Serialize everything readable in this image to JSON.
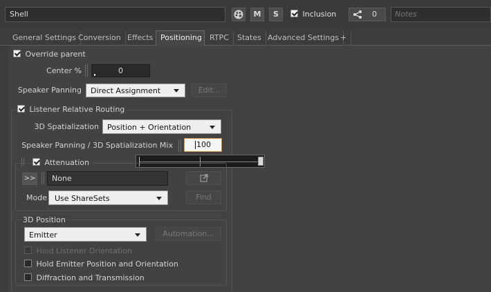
{
  "header": {
    "name_value": "Shell",
    "color_icon": "palette-icon",
    "mute_label": "M",
    "solo_label": "S",
    "inclusion_label": "Inclusion",
    "references_count": "0",
    "notes_placeholder": "Notes"
  },
  "tabs": [
    {
      "label": "General Settings"
    },
    {
      "label": "Conversion"
    },
    {
      "label": "Effects"
    },
    {
      "label": "Positioning",
      "active": true
    },
    {
      "label": "RTPC"
    },
    {
      "label": "States"
    },
    {
      "label": "Advanced Settings"
    },
    {
      "label": "+"
    }
  ],
  "positioning": {
    "override_parent_label": "Override parent",
    "center_label": "Center %",
    "center_value": "0",
    "speaker_panning_label": "Speaker Panning",
    "speaker_panning_value": "Direct Assignment",
    "edit_label": "Edit...",
    "listener_relative_routing_label": "Listener Relative Routing",
    "spatialization_label": "3D Spatialization",
    "spatialization_value": "Position + Orientation",
    "mix_label": "Speaker Panning / 3D Spatialization Mix",
    "mix_value": "100",
    "mix_fraction": 1.0,
    "attenuation_label": "Attenuation",
    "expand_label": ">>",
    "attenuation_value": "None",
    "mode_label": "Mode",
    "mode_value": "Use ShareSets",
    "find_label": "Find",
    "position_group_label": "3D Position",
    "position_value": "Emitter",
    "automation_label": "Automation...",
    "hold_listener_label": "Hold Listener Orientation",
    "hold_emitter_label": "Hold Emitter Position and Orientation",
    "diffraction_label": "Diffraction and Transmission"
  }
}
